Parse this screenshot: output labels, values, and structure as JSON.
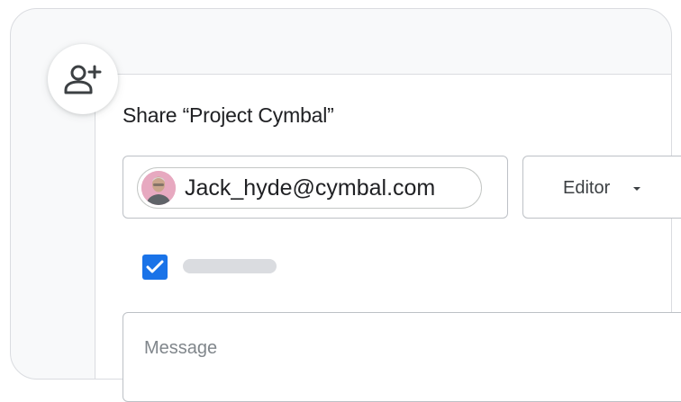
{
  "share_dialog": {
    "title": "Share “Project Cymbal”",
    "recipient_email": "Jack_hyde@cymbal.com",
    "role": "Editor",
    "message_placeholder": "Message",
    "notify_checked": true
  },
  "icons": {
    "fab": "add-person-icon",
    "role_dropdown": "caret-down-icon",
    "checkbox": "checkmark-icon"
  },
  "colors": {
    "accent": "#1a73e8",
    "border": "#dadce0",
    "text": "#202124",
    "placeholder": "#80868b"
  }
}
